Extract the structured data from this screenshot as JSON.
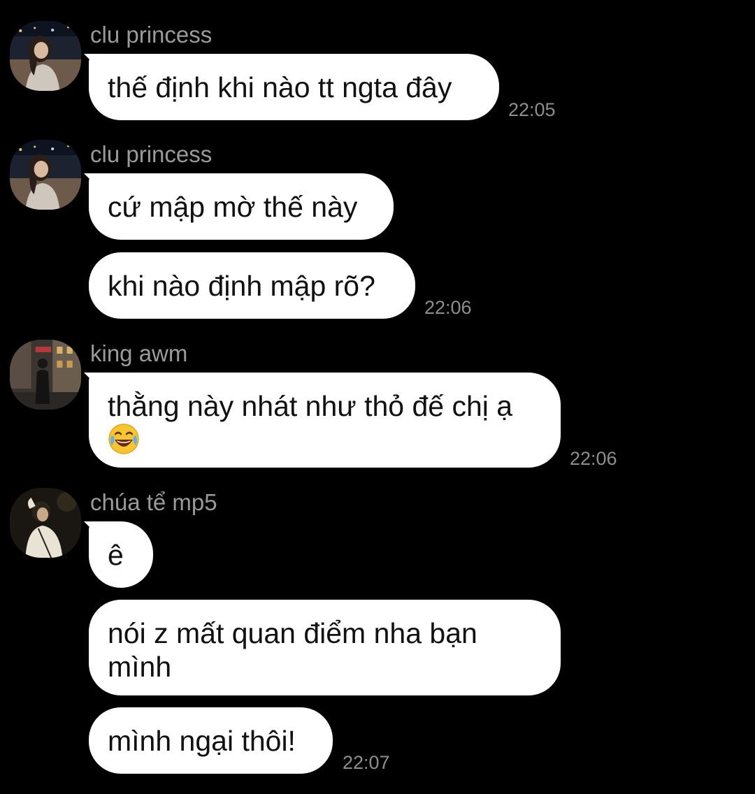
{
  "messages": [
    {
      "sender": "clu princess",
      "avatar": "girl-night-city-avatar",
      "bubbles": [
        {
          "text": "thế định khi nào tt ngta đây"
        }
      ],
      "time": "22:05"
    },
    {
      "sender": "clu princess",
      "avatar": "girl-night-city-avatar",
      "bubbles": [
        {
          "text": "cứ mập mờ thế này"
        },
        {
          "text": "khi nào định mập rõ?"
        }
      ],
      "time": "22:06"
    },
    {
      "sender": "king awm",
      "avatar": "street-photo-avatar",
      "bubbles": [
        {
          "line1": "thằng này nhát như thỏ đế chị ạ",
          "emoji": "laughing-tears-emoji"
        }
      ],
      "time": "22:06"
    },
    {
      "sender": "chúa tể mp5",
      "avatar": "boy-white-shirt-avatar",
      "bubbles": [
        {
          "text": "ê"
        },
        {
          "line1": "nói z mất quan điểm nha bạn",
          "line2": "mình"
        },
        {
          "text": "mình ngại thôi!"
        }
      ],
      "time": "22:07"
    }
  ]
}
